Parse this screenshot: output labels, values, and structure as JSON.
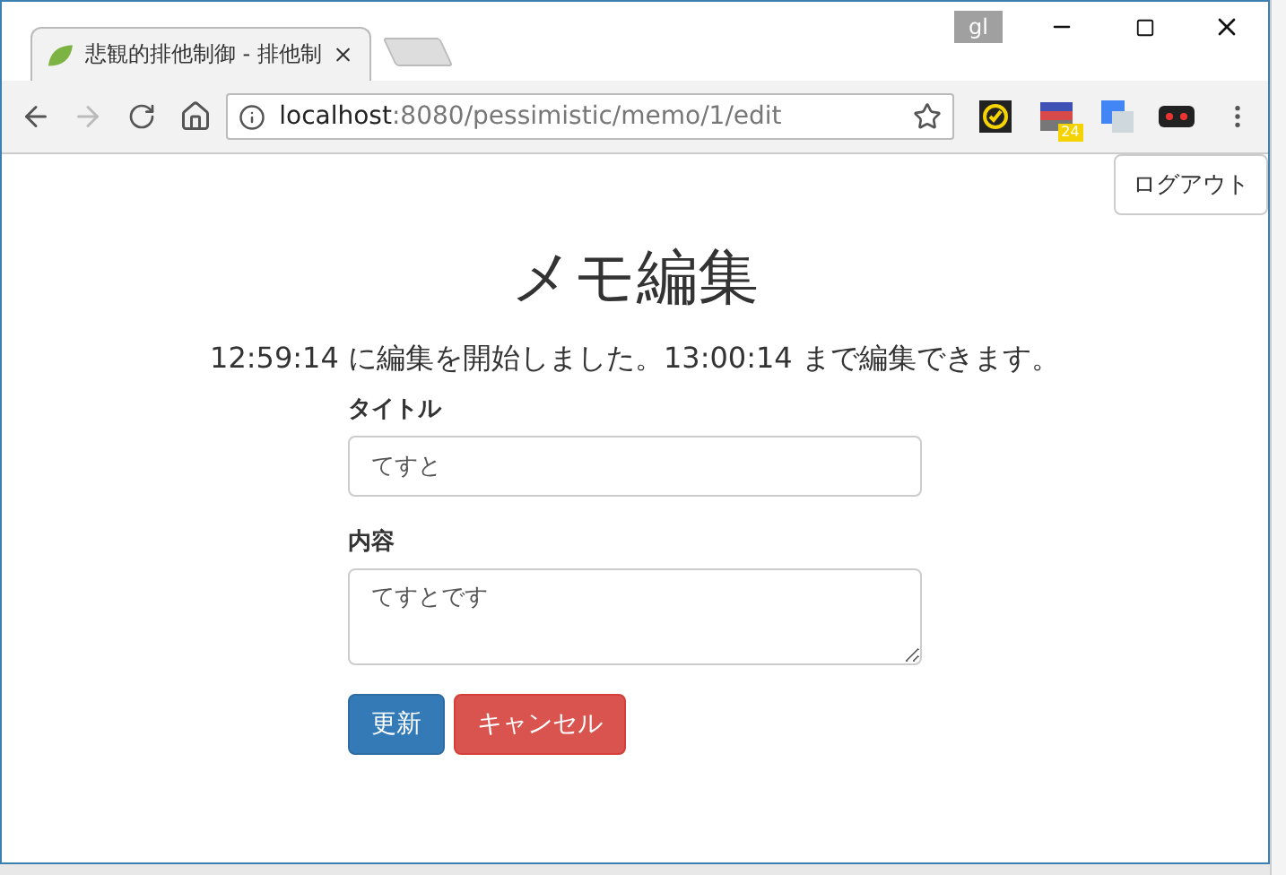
{
  "browser": {
    "profile": "gl",
    "tabs": [
      {
        "title": "悲観的排他制御 - 排他制",
        "selected": true
      }
    ],
    "address": {
      "host": "localhost",
      "path": ":8080/pessimistic/memo/1/edit"
    },
    "extension_badge": "24"
  },
  "page": {
    "logout": "ログアウト",
    "heading": "メモ編集",
    "notice": "12:59:14 に編集を開始しました。13:00:14 まで編集できます。",
    "fields": [
      {
        "kind": "input",
        "label": "タイトル",
        "value": "てすと"
      },
      {
        "kind": "textarea",
        "label": "内容",
        "value": "てすとです"
      }
    ],
    "buttons": [
      {
        "kind": "primary",
        "label": "更新"
      },
      {
        "kind": "danger",
        "label": "キャンセル"
      }
    ]
  }
}
